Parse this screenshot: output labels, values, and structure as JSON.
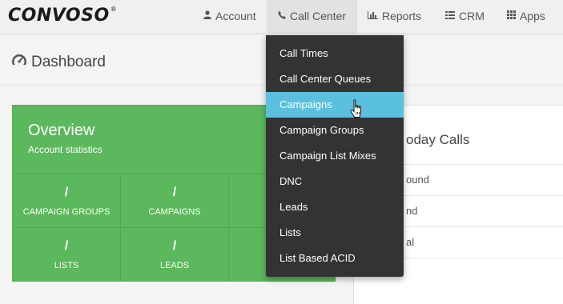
{
  "brand": {
    "logo_text": "CONVOSO",
    "reg_mark": "®"
  },
  "navbar": {
    "items": [
      {
        "label": "Account",
        "icon": "user-icon"
      },
      {
        "label": "Call Center",
        "icon": "phone-icon"
      },
      {
        "label": "Reports",
        "icon": "bar-chart-icon"
      },
      {
        "label": "CRM",
        "icon": "list-icon"
      },
      {
        "label": "Apps",
        "icon": "grid-icon"
      }
    ]
  },
  "page": {
    "title": "Dashboard",
    "icon": "dashboard-gauge-icon"
  },
  "overview": {
    "title": "Overview",
    "subtitle": "Account statistics",
    "stats": [
      {
        "value": "/",
        "label": "CAMPAIGN GROUPS"
      },
      {
        "value": "/",
        "label": "CAMPAIGNS"
      },
      {
        "value": "",
        "label": ""
      },
      {
        "value": "/",
        "label": "LISTS"
      },
      {
        "value": "/",
        "label": "LEADS"
      },
      {
        "value": "",
        "label": ""
      }
    ]
  },
  "today_calls": {
    "title": "oday Calls",
    "rows": [
      "ound",
      "nd",
      "al"
    ]
  },
  "call_center_menu": {
    "items": [
      "Call Times",
      "Call Center Queues",
      "Campaigns",
      "Campaign Groups",
      "Campaign List Mixes",
      "DNC",
      "Leads",
      "Lists",
      "List Based ACID"
    ],
    "highlighted": "Campaigns"
  },
  "colors": {
    "overview_green": "#5cb85c",
    "menu_dark": "#333333",
    "menu_highlight": "#5bc0de"
  }
}
